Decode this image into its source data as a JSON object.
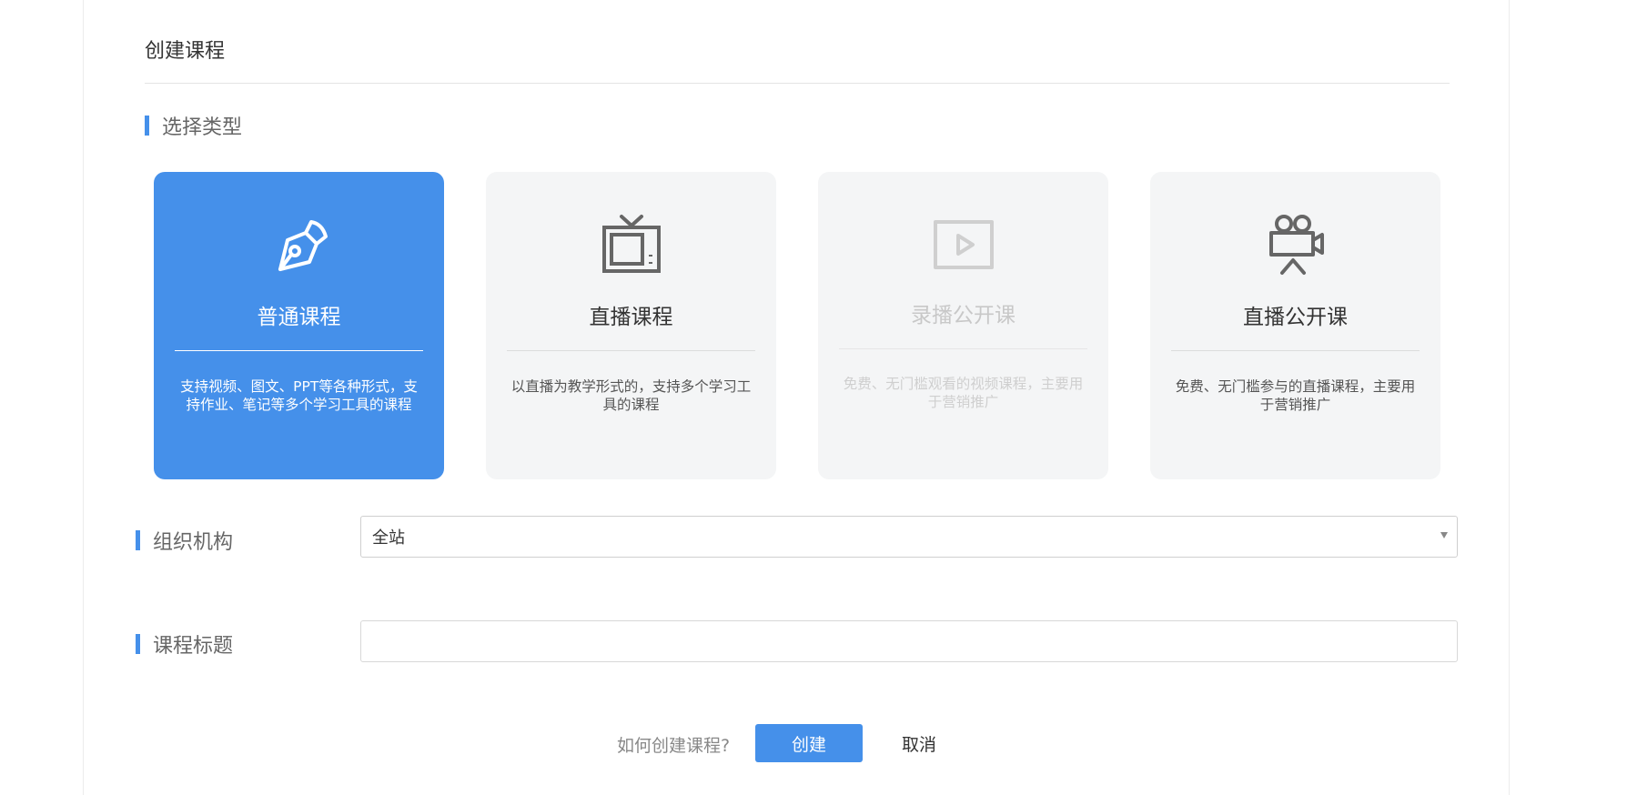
{
  "page": {
    "title": "创建课程"
  },
  "type_section": {
    "label": "选择类型",
    "cards": [
      {
        "name": "普通课程",
        "desc": "支持视频、图文、PPT等各种形式，支持作业、笔记等多个学习工具的课程",
        "icon": "pen-nib-icon",
        "state": "selected"
      },
      {
        "name": "直播课程",
        "desc": "以直播为教学形式的，支持多个学习工具的课程",
        "icon": "tv-icon",
        "state": "normal"
      },
      {
        "name": "录播公开课",
        "desc": "免费、无门槛观看的视频课程，主要用于营销推广",
        "icon": "video-play-icon",
        "state": "disabled"
      },
      {
        "name": "直播公开课",
        "desc": "免费、无门槛参与的直播课程，主要用于营销推广",
        "icon": "movie-camera-icon",
        "state": "normal"
      }
    ]
  },
  "org_field": {
    "label": "组织机构",
    "value": "全站"
  },
  "title_field": {
    "label": "课程标题",
    "value": "",
    "placeholder": ""
  },
  "footer": {
    "help_link": "如何创建课程?",
    "create_label": "创建",
    "cancel_label": "取消"
  },
  "colors": {
    "accent": "#4590ea",
    "card_bg": "#f4f5f6"
  }
}
